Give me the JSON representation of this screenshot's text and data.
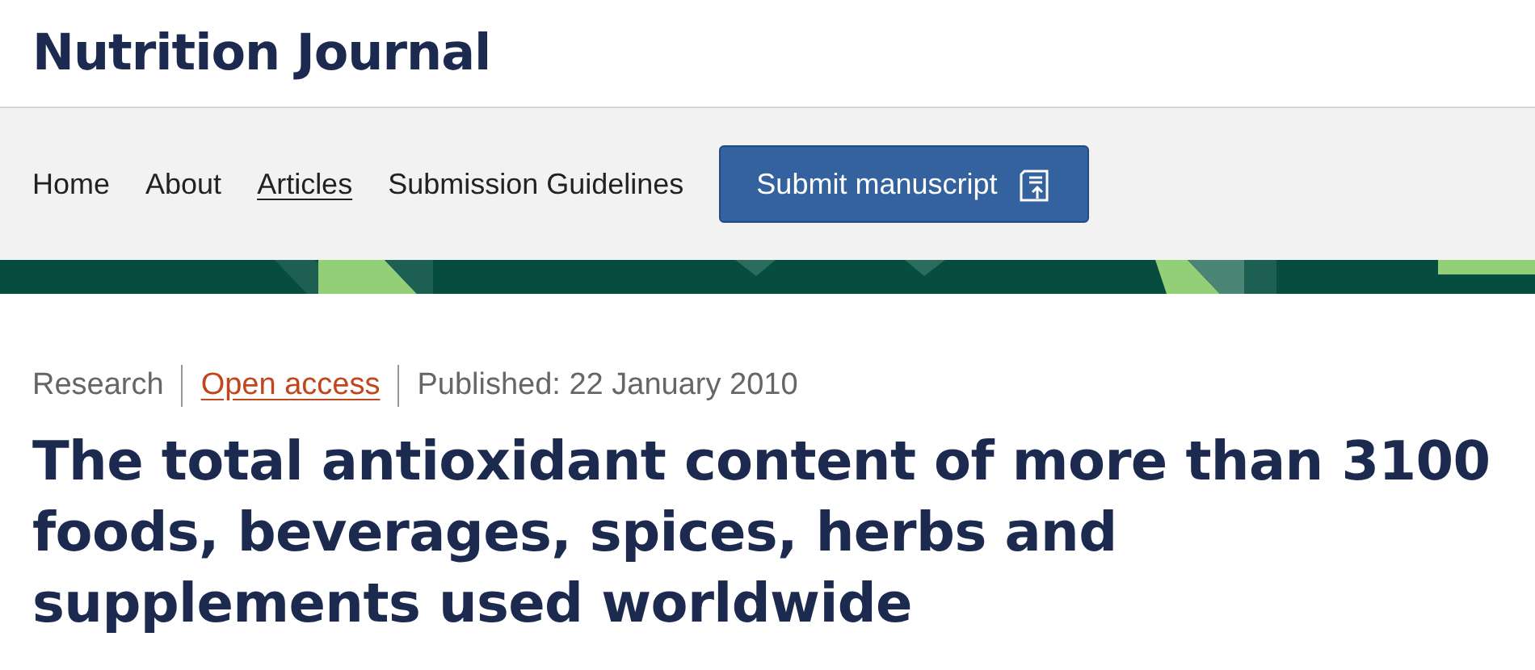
{
  "journal": {
    "title": "Nutrition Journal"
  },
  "nav": {
    "items": [
      {
        "label": "Home",
        "selected": false
      },
      {
        "label": "About",
        "selected": false
      },
      {
        "label": "Articles",
        "selected": true
      },
      {
        "label": "Submission Guidelines",
        "selected": false
      }
    ],
    "submit_button": "Submit manuscript"
  },
  "article": {
    "type": "Research",
    "access": "Open access",
    "published": "Published: 22 January 2010",
    "title": "The total antioxidant content of more than 3100 foods, beverages, spices, herbs and supplements used worldwide"
  }
}
